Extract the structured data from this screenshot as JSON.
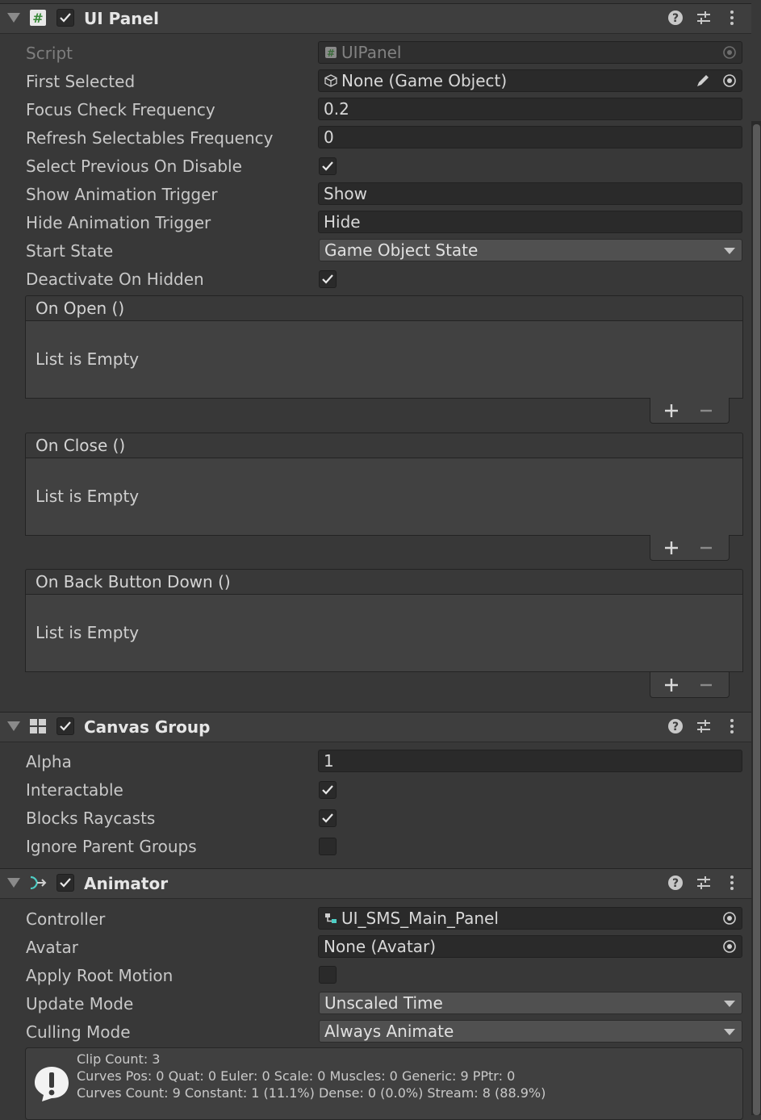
{
  "ui_panel": {
    "title": "UI Panel",
    "fields": {
      "script_label": "Script",
      "script_value": "UIPanel",
      "first_selected_label": "First Selected",
      "first_selected_value": "None (Game Object)",
      "focus_check_label": "Focus Check Frequency",
      "focus_check_value": "0.2",
      "refresh_label": "Refresh Selectables Frequency",
      "refresh_value": "0",
      "select_prev_label": "Select Previous On Disable",
      "show_trigger_label": "Show Animation Trigger",
      "show_trigger_value": "Show",
      "hide_trigger_label": "Hide Animation Trigger",
      "hide_trigger_value": "Hide",
      "start_state_label": "Start State",
      "start_state_value": "Game Object State",
      "deactivate_label": "Deactivate On Hidden"
    },
    "events": [
      {
        "title": "On Open ()",
        "empty": "List is Empty"
      },
      {
        "title": "On Close ()",
        "empty": "List is Empty"
      },
      {
        "title": "On Back Button Down ()",
        "empty": "List is Empty"
      }
    ]
  },
  "canvas_group": {
    "title": "Canvas Group",
    "alpha_label": "Alpha",
    "alpha_value": "1",
    "interactable_label": "Interactable",
    "blocks_label": "Blocks Raycasts",
    "ignore_label": "Ignore Parent Groups"
  },
  "animator": {
    "title": "Animator",
    "controller_label": "Controller",
    "controller_value": "UI_SMS_Main_Panel",
    "avatar_label": "Avatar",
    "avatar_value": "None (Avatar)",
    "root_motion_label": "Apply Root Motion",
    "update_mode_label": "Update Mode",
    "update_mode_value": "Unscaled Time",
    "culling_mode_label": "Culling Mode",
    "culling_mode_value": "Always Animate",
    "info_lines": [
      "Clip Count: 3",
      "Curves Pos: 0 Quat: 0 Euler: 0 Scale: 0 Muscles: 0 Generic: 9 PPtr: 0",
      "Curves Count: 9 Constant: 1 (11.1%) Dense: 0 (0.0%) Stream: 8 (88.9%)"
    ]
  },
  "icons": {
    "help": "help-icon",
    "preset": "preset-icon",
    "menu": "kebab-menu-icon",
    "object_picker": "object-picker-icon",
    "edit": "pencil-icon",
    "plus": "plus-icon",
    "minus": "minus-icon",
    "info": "info-icon"
  },
  "colors": {
    "background": "#383838",
    "field": "#2a2a2a",
    "header": "#3e3e3e",
    "accent_teal": "#4ecdc4"
  }
}
